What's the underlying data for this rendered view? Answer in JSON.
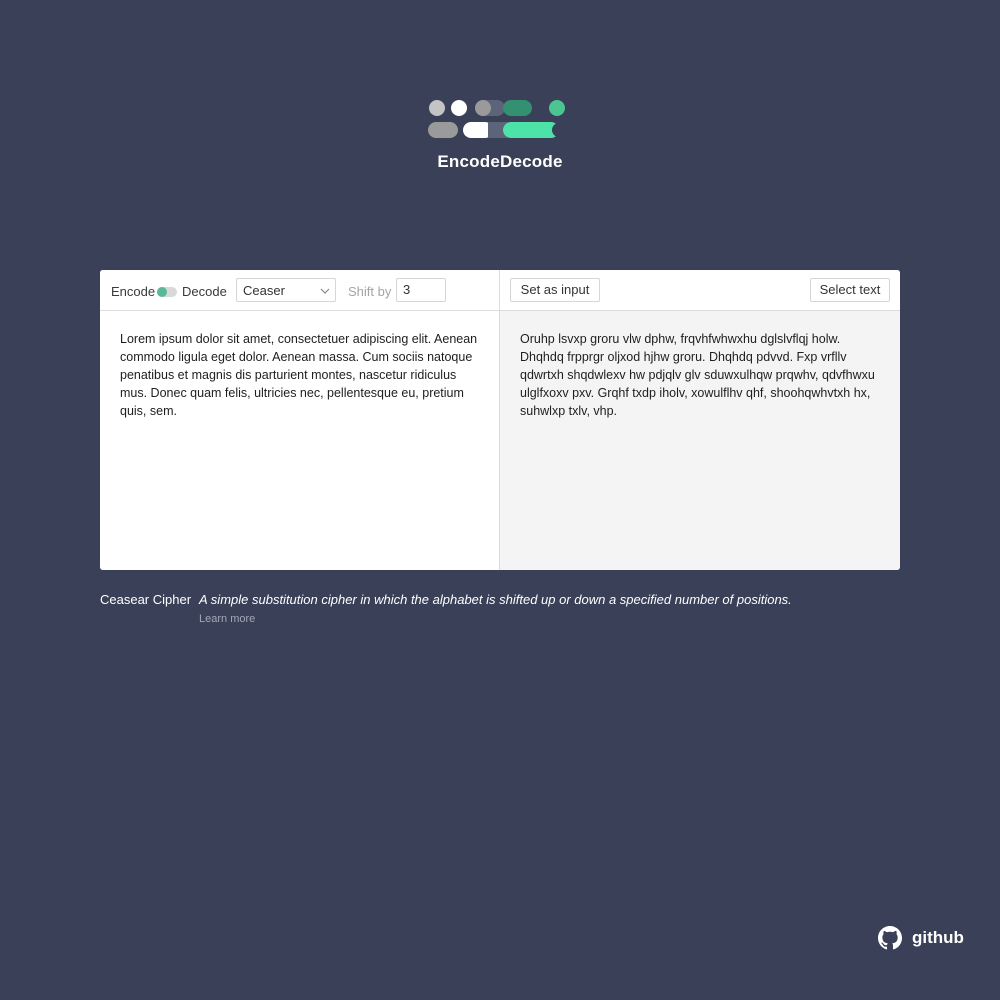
{
  "app": {
    "title": "EncodeDecode"
  },
  "toolbar": {
    "encode_label": "Encode",
    "decode_label": "Decode",
    "mode_selected": "Encode",
    "cipher_selected": "Ceaser",
    "shift_label": "Shift by",
    "shift_value": "3",
    "set_as_input_label": "Set as input",
    "select_text_label": "Select text"
  },
  "input": {
    "text": "Lorem ipsum dolor sit amet, consectetuer adipiscing elit. Aenean commodo ligula eget dolor. Aenean massa. Cum sociis natoque penatibus et magnis dis parturient montes, nascetur ridiculus mus. Donec quam felis, ultricies nec, pellentesque eu, pretium quis, sem."
  },
  "output": {
    "text": "Oruhp lsvxp groru vlw dphw, frqvhfwhwxhu dglslvflqj holw. Dhqhdq frpprgr oljxod hjhw groru. Dhqhdq pdvvd. Fxp vrfllv qdwrtxh shqdwlexv hw pdjqlv glv sduwxulhqw prqwhv, qdvfhwxu ulglfxoxv pxv. Grqhf txdp iholv, xowulflhv qhf, shoohqwhvtxh hx, suhwlxp txlv, vhp."
  },
  "cipher_info": {
    "name": "Ceasear Cipher",
    "description": "A simple substitution cipher in which the alphabet is shifted up or down a specified number of positions.",
    "learn_more": "Learn more"
  },
  "footer": {
    "github_label": "github"
  },
  "colors": {
    "background": "#394057",
    "accent_green": "#59b89a",
    "logo_light_green": "#4de2a7",
    "logo_dark_green": "#339171",
    "logo_grey": "#9a9a9a",
    "logo_light_grey": "#c4c4c4",
    "logo_slate": "#5b6478"
  },
  "icons": {
    "logo": "encode-decode-pill-logo",
    "select_arrow": "chevron-down-icon",
    "github": "github-octocat-icon"
  }
}
